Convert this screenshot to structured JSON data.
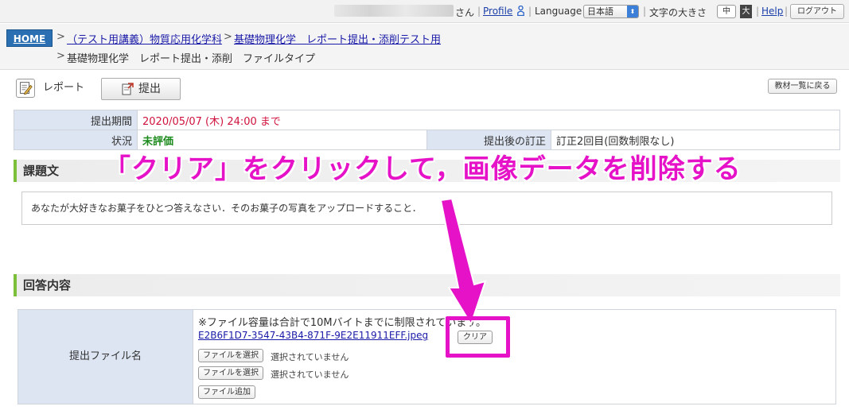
{
  "topbar": {
    "san": "さん",
    "profile": "Profile",
    "language_label": "Language",
    "language_value": "日本語",
    "font_size_label": "文字の大きさ",
    "size_mid": "中",
    "size_big": "大",
    "help": "Help",
    "logout": "ログアウト"
  },
  "breadcrumb": {
    "home": "HOME",
    "course": "（テスト用講義）物質応用化学科",
    "assignment": "基礎物理化学　レポート提出・添削テスト用",
    "current": "基礎物理化学　レポート提出・添削　ファイルタイプ"
  },
  "toolbar": {
    "report": "レポート",
    "submit": "提出",
    "back": "教材一覧に戻る"
  },
  "info": {
    "period_label": "提出期間",
    "period_value": "2020/05/07 (木) 24:00 まで",
    "status_label": "状況",
    "status_value": "未評価",
    "revision_label": "提出後の訂正",
    "revision_value": "訂正2回目(回数制限なし)"
  },
  "question": {
    "header": "課題文",
    "text": "あなたが大好きなお菓子をひとつ答えなさい．そのお菓子の写真をアップロードすること．"
  },
  "answer": {
    "header": "回答内容",
    "file_label": "提出ファイル名",
    "note": "※ファイル容量は合計で10Mバイトまでに制限されています。",
    "file_name": "E2B6F1D7-3547-43B4-871F-9E2E11911EFF.jpeg",
    "clear": "クリア",
    "choose_file": "ファイルを選択",
    "not_selected": "選択されていません",
    "add_file": "ファイル追加"
  },
  "annotation": {
    "text": "「クリア」をクリックして，画像データを削除する",
    "color": "#e612c8"
  }
}
